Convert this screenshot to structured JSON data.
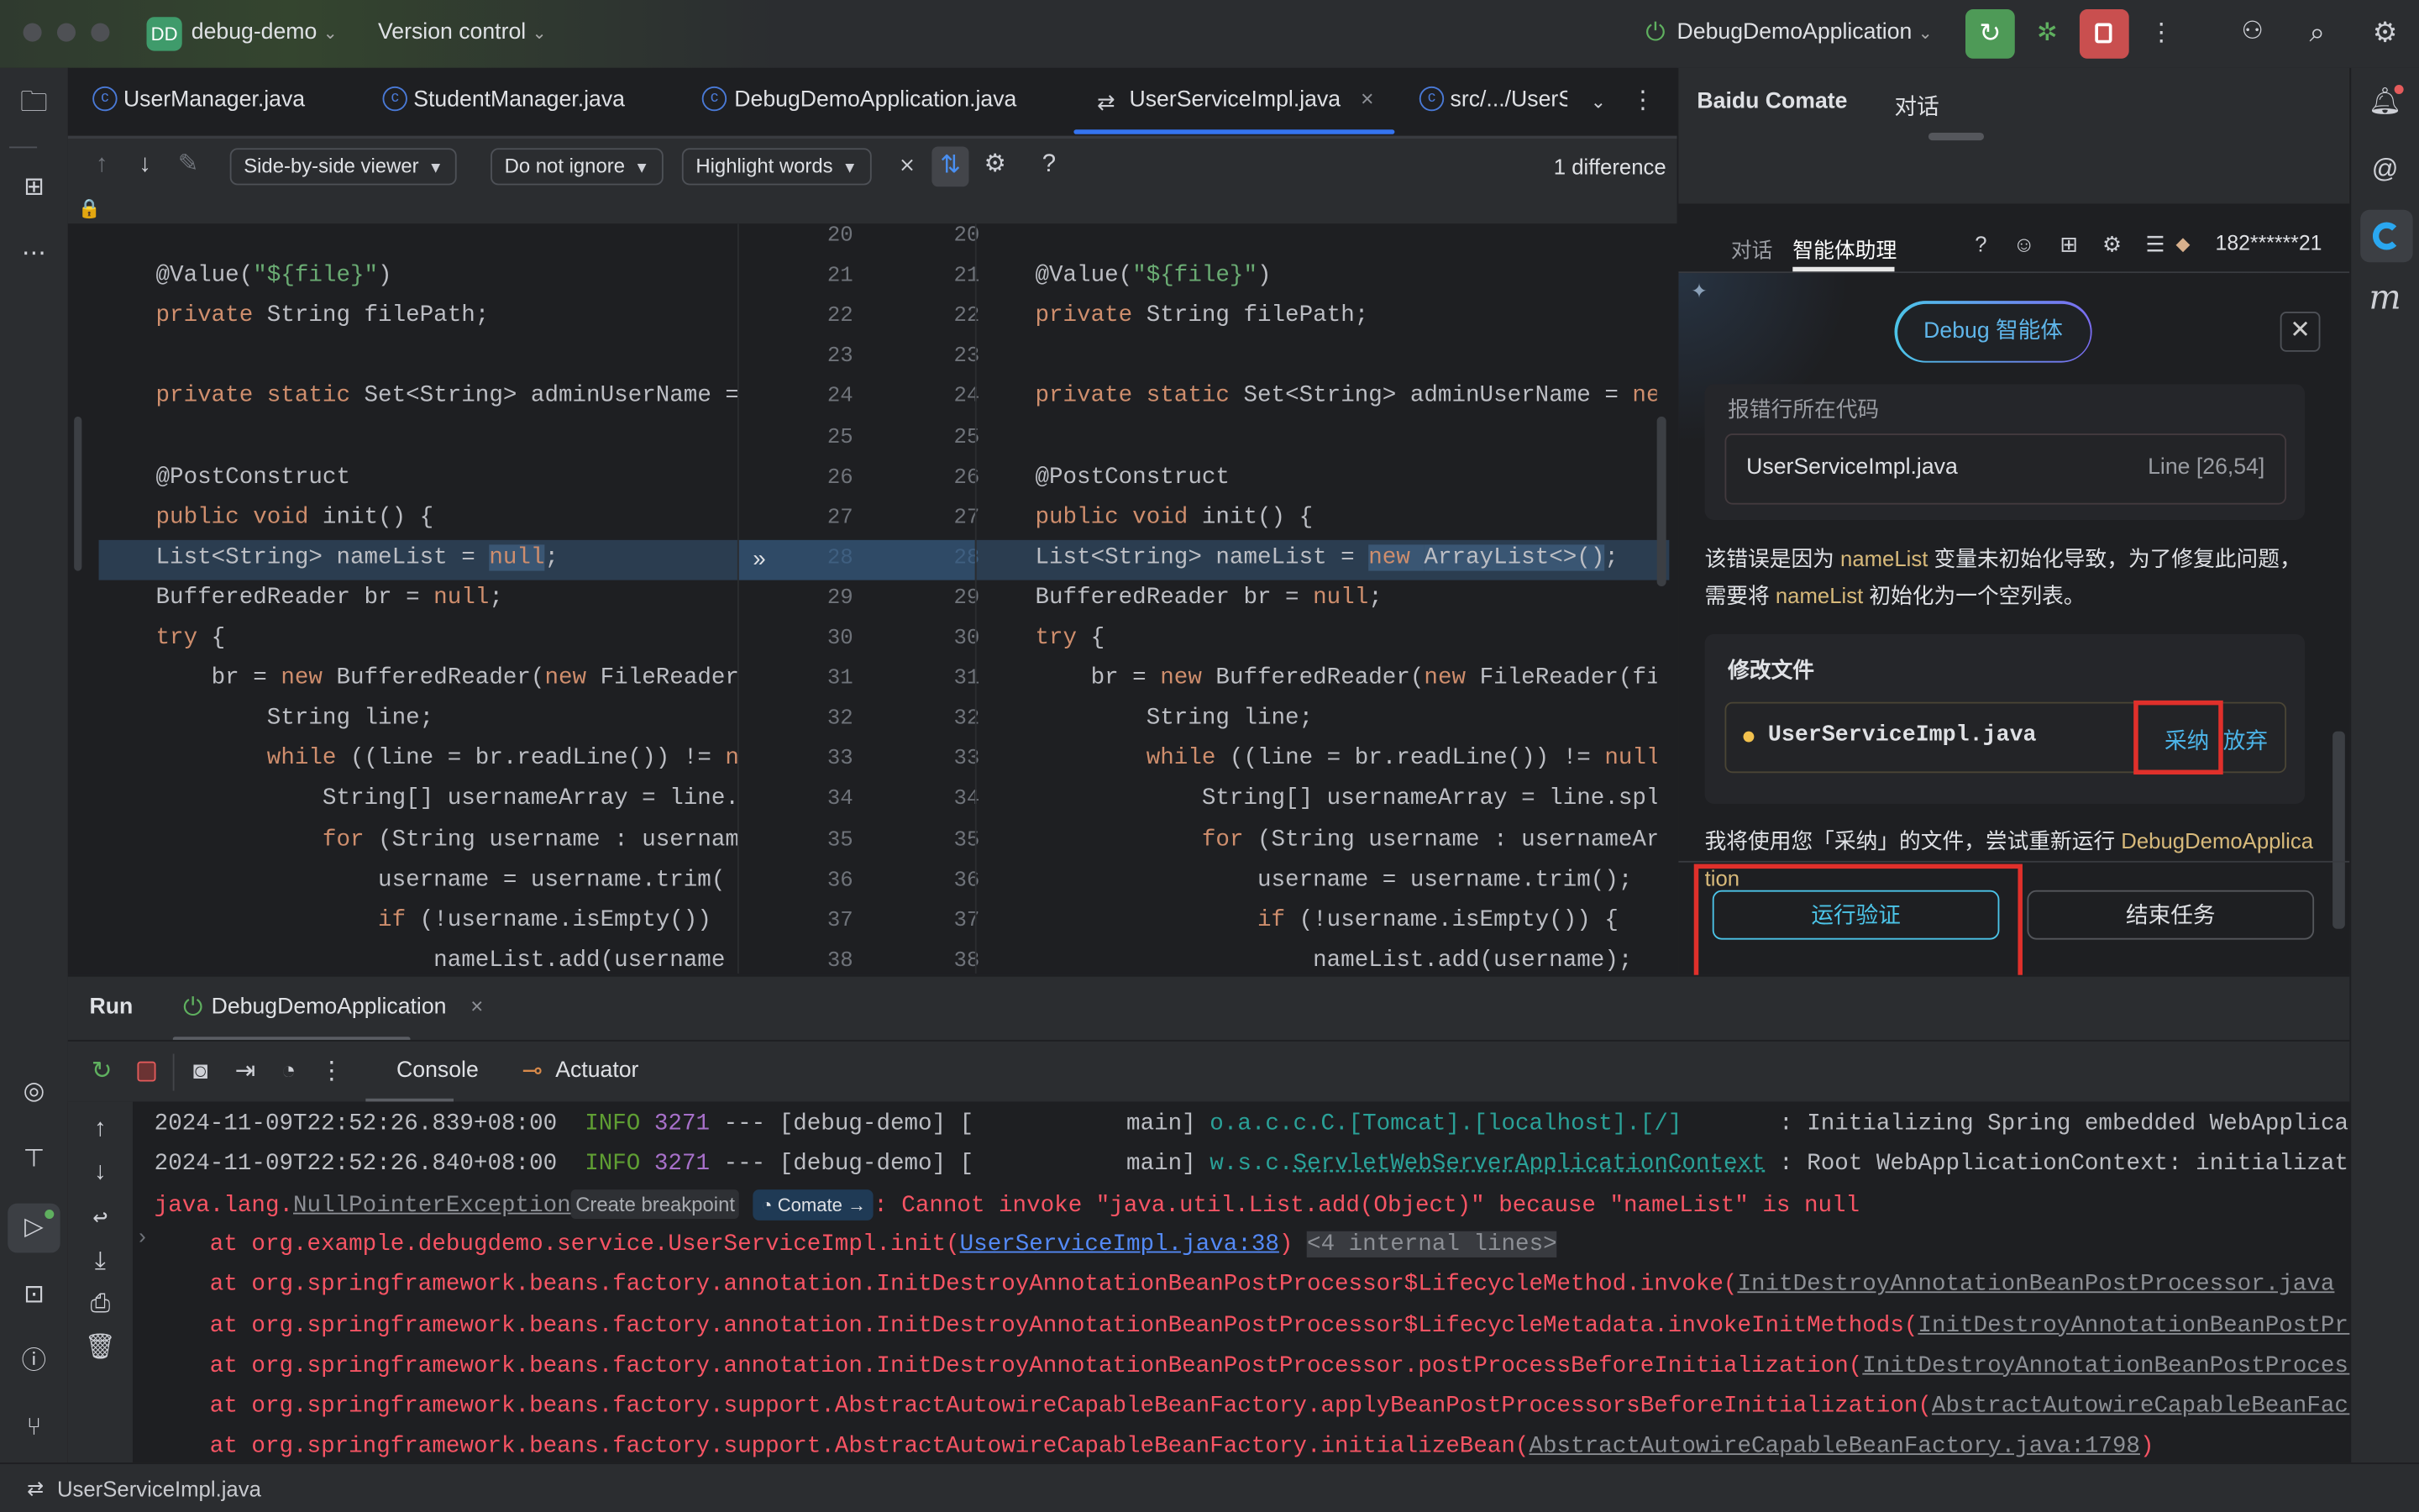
{
  "titlebar": {
    "project_badge": "DD",
    "project_name": "debug-demo",
    "vcs_label": "Version control",
    "run_config": "DebugDemoApplication",
    "accent_green": "#4e9a57",
    "accent_red": "#c94f4f"
  },
  "editor_tabs": [
    {
      "label": "UserManager.java"
    },
    {
      "label": "StudentManager.java"
    },
    {
      "label": "DebugDemoApplication.java"
    },
    {
      "label": "UserServiceImpl.java",
      "active": true
    },
    {
      "label": "src/.../UserS"
    }
  ],
  "diff_toolbar": {
    "viewer": "Side-by-side viewer",
    "ignore": "Do not ignore",
    "highlight": "Highlight words",
    "differences": "1 difference"
  },
  "diff": {
    "line_numbers": [
      20,
      21,
      22,
      23,
      24,
      25,
      26,
      27,
      28,
      29,
      30,
      31,
      32,
      33,
      34,
      35,
      36,
      37,
      38
    ],
    "changed_line": 28,
    "left": [
      [],
      [
        [
          "@Value(",
          ""
        ],
        [
          "\"${file}\"",
          "s"
        ],
        [
          ")",
          ""
        ]
      ],
      [
        [
          "private ",
          "k"
        ],
        [
          "String filePath;",
          ""
        ]
      ],
      [],
      [
        [
          "private static ",
          "k"
        ],
        [
          "Set<String> adminUserName = ",
          ""
        ],
        [
          "new",
          "k"
        ]
      ],
      [],
      [
        [
          "@PostConstruct",
          ""
        ]
      ],
      [
        [
          "public void ",
          "k"
        ],
        [
          "init() {",
          ""
        ]
      ],
      [
        [
          "List<String> nameList = ",
          ""
        ],
        [
          "null",
          "k h"
        ],
        [
          ";",
          ""
        ]
      ],
      [
        [
          "BufferedReader br = ",
          ""
        ],
        [
          "null",
          "k"
        ],
        [
          ";",
          ""
        ]
      ],
      [
        [
          "try ",
          "k"
        ],
        [
          "{",
          ""
        ]
      ],
      [
        [
          "    br = ",
          ""
        ],
        [
          "new ",
          "k"
        ],
        [
          "BufferedReader(",
          ""
        ],
        [
          "new ",
          "k"
        ],
        [
          "FileReader(fi",
          ""
        ]
      ],
      [
        [
          "        String line;",
          ""
        ]
      ],
      [
        [
          "        ",
          ""
        ],
        [
          "while ",
          "k"
        ],
        [
          "((line = br.readLine()) != ",
          ""
        ],
        [
          "null",
          "k"
        ],
        [
          ")",
          ""
        ]
      ],
      [
        [
          "            String[] usernameArray = line.spl",
          ""
        ]
      ],
      [
        [
          "            ",
          ""
        ],
        [
          "for ",
          "k"
        ],
        [
          "(String username : usernameAr",
          ""
        ]
      ],
      [
        [
          "                username = username.trim(",
          ""
        ]
      ],
      [
        [
          "                ",
          ""
        ],
        [
          "if ",
          "k"
        ],
        [
          "(!username.isEmpty())",
          ""
        ]
      ],
      [
        [
          "                    nameList.add(username",
          ""
        ]
      ]
    ],
    "right": [
      [],
      [
        [
          "@Value(",
          ""
        ],
        [
          "\"${file}\"",
          "s"
        ],
        [
          ")",
          ""
        ]
      ],
      [
        [
          "private ",
          "k"
        ],
        [
          "String filePath;",
          ""
        ]
      ],
      [],
      [
        [
          "private static ",
          "k"
        ],
        [
          "Set<String> adminUserName = ",
          ""
        ],
        [
          "new",
          "k"
        ]
      ],
      [],
      [
        [
          "@PostConstruct",
          ""
        ]
      ],
      [
        [
          "public void ",
          "k"
        ],
        [
          "init() {",
          ""
        ]
      ],
      [
        [
          "List<String> nameList = ",
          ""
        ],
        [
          "new ",
          "k h"
        ],
        [
          "ArrayList<>()",
          "h"
        ],
        [
          ";",
          ""
        ]
      ],
      [
        [
          "BufferedReader br = ",
          ""
        ],
        [
          "null",
          "k"
        ],
        [
          ";",
          ""
        ]
      ],
      [
        [
          "try ",
          "k"
        ],
        [
          "{",
          ""
        ]
      ],
      [
        [
          "    br = ",
          ""
        ],
        [
          "new ",
          "k"
        ],
        [
          "BufferedReader(",
          ""
        ],
        [
          "new ",
          "k"
        ],
        [
          "FileReader(fi",
          ""
        ]
      ],
      [
        [
          "        String line;",
          ""
        ]
      ],
      [
        [
          "        ",
          ""
        ],
        [
          "while ",
          "k"
        ],
        [
          "((line = br.readLine()) != ",
          ""
        ],
        [
          "null",
          "k"
        ],
        [
          ")",
          ""
        ]
      ],
      [
        [
          "            String[] usernameArray = line.spl",
          ""
        ]
      ],
      [
        [
          "            ",
          ""
        ],
        [
          "for ",
          "k"
        ],
        [
          "(String username : usernameAr",
          ""
        ]
      ],
      [
        [
          "                username = username.trim();",
          ""
        ]
      ],
      [
        [
          "                ",
          ""
        ],
        [
          "if ",
          "k"
        ],
        [
          "(!username.isEmpty()) {",
          ""
        ]
      ],
      [
        [
          "                    nameList.add(username);",
          ""
        ]
      ]
    ]
  },
  "comate": {
    "title": "Baidu Comate",
    "header_tab": "对话",
    "subtabs": [
      "对话",
      "智能体助理"
    ],
    "active_subtab": "智能体助理",
    "user": "182******21",
    "agent_pill": "Debug 智能体",
    "error_card": {
      "label": "报错行所在代码",
      "file": "UserServiceImpl.java",
      "lines": "Line [26,54]"
    },
    "explanation": {
      "t1": "该错误是因为 ",
      "v1": "nameList",
      "t2": " 变量未初始化导致，为了修复此问题，需要将 ",
      "v2": "nameList",
      "t3": " 初始化为一个空列表。"
    },
    "modify_card": {
      "label": "修改文件",
      "file": "UserServiceImpl.java",
      "accept": "采纳",
      "reject": "放弃"
    },
    "followup": {
      "text": "我将使用您「采纳」的文件，尝试重新运行 ",
      "app": "DebugDemoApplication"
    },
    "run_verify": "运行验证",
    "end_task": "结束任务",
    "accent_cyan": "#4cc4e8"
  },
  "run_panel": {
    "title": "Run",
    "config_tab": "DebugDemoApplication",
    "console_tab": "Console",
    "actuator_tab": "Actuator"
  },
  "console": [
    [
      [
        "2024-11-09T22:52:26.839+08:00 ",
        "cg"
      ],
      [
        " INFO ",
        "cgr"
      ],
      [
        "3271",
        "cp"
      ],
      [
        " --- [debug-demo] [           main] ",
        "cg"
      ],
      [
        "o.a.c.c.C.[Tomcat].[localhost].[/]",
        "ct"
      ],
      [
        "       : Initializing Spring embedded WebApplicationContext",
        "cg"
      ]
    ],
    [
      [
        "2024-11-09T22:52:26.840+08:00 ",
        "cg"
      ],
      [
        " INFO ",
        "cgr"
      ],
      [
        "3271",
        "cp"
      ],
      [
        " --- [debug-demo] [           main] ",
        "cg"
      ],
      [
        "w.s.c.",
        "ct"
      ],
      [
        "ServletWebServerApplicationContext",
        "ctu"
      ],
      [
        " : Root WebApplicationContext: initialization",
        "cg"
      ]
    ],
    [
      [
        "java.lang.",
        "cr"
      ],
      [
        "NullPointerException",
        "cru"
      ],
      [
        "Create breakpoint",
        "cbadge"
      ],
      [
        " ",
        ""
      ],
      [
        "◔ Comate →",
        "ccomate"
      ],
      [
        ": Cannot invoke \"java.util.List.add(Object)\" because \"nameList\" is null",
        "cr"
      ]
    ],
    [
      [
        "    at org.example.debugdemo.service.UserServiceImpl.init(",
        "cr"
      ],
      [
        "UserServiceImpl.java:38",
        "cl2"
      ],
      [
        ")",
        "cr"
      ],
      [
        " ",
        ""
      ],
      [
        "<4 internal lines>",
        "cb"
      ]
    ],
    [
      [
        "    at org.springframework.beans.factory.annotation.InitDestroyAnnotationBeanPostProcessor$LifecycleMethod.invoke(",
        "cr"
      ],
      [
        "InitDestroyAnnotationBeanPostProcessor.java",
        "cru"
      ]
    ],
    [
      [
        "    at org.springframework.beans.factory.annotation.InitDestroyAnnotationBeanPostProcessor$LifecycleMetadata.invokeInitMethods(",
        "cr"
      ],
      [
        "InitDestroyAnnotationBeanPostProcessor.java",
        "cru"
      ]
    ],
    [
      [
        "    at org.springframework.beans.factory.annotation.InitDestroyAnnotationBeanPostProcessor.postProcessBeforeInitialization(",
        "cr"
      ],
      [
        "InitDestroyAnnotationBeanPostProcessor.java",
        "cru"
      ]
    ],
    [
      [
        "    at org.springframework.beans.factory.support.AbstractAutowireCapableBeanFactory.applyBeanPostProcessorsBeforeInitialization(",
        "cr"
      ],
      [
        "AbstractAutowireCapableBeanFactory.java",
        "cru"
      ]
    ],
    [
      [
        "    at org.springframework.beans.factory.support.AbstractAutowireCapableBeanFactory.initializeBean(",
        "cr"
      ],
      [
        "AbstractAutowireCapableBeanFactory.java:1798",
        "cru"
      ],
      [
        ")",
        "cr"
      ]
    ]
  ],
  "status_bar": {
    "file": "UserServiceImpl.java"
  }
}
